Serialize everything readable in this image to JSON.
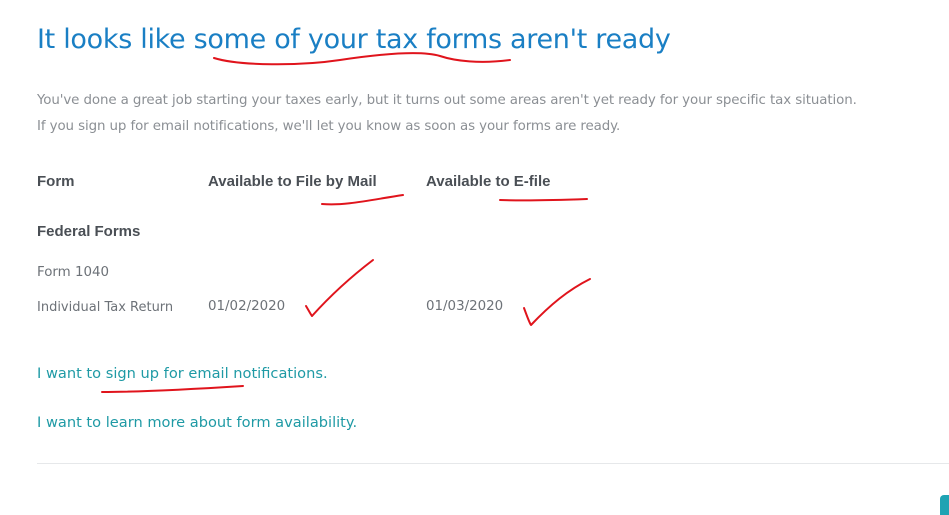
{
  "header": {
    "title": "It looks like some of your tax forms aren't ready"
  },
  "intro": {
    "line1": "You've done a great job starting your taxes early, but it turns out some areas aren't yet ready for your specific tax situation.",
    "line2": "If you sign up for email notifications, we'll let you know as soon as your forms are ready."
  },
  "table": {
    "columns": [
      "Form",
      "Available to File by Mail",
      "Available to E-file"
    ],
    "section": "Federal Forms",
    "rows": [
      {
        "form_name": "Form 1040",
        "form_description": "Individual Tax Return",
        "mail_date": "01/02/2020",
        "efile_date": "01/03/2020"
      }
    ]
  },
  "links": {
    "email_signup": "I want to sign up for email notifications.",
    "learn_more": "I want to learn more about form availability."
  },
  "colors": {
    "title": "#1a7fc4",
    "link": "#1f9aa5",
    "annotation": "#e0141c"
  }
}
